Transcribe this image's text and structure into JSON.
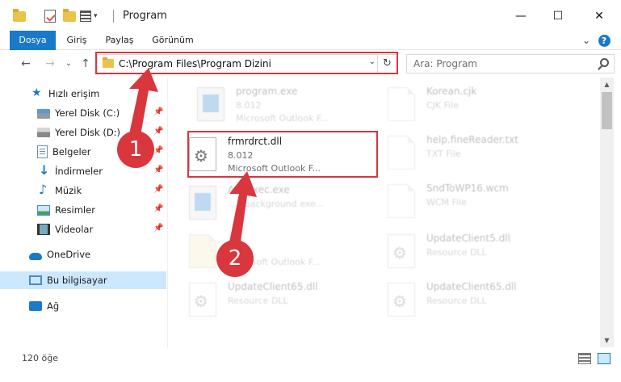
{
  "window": {
    "title": "Program",
    "minimize": "—",
    "maximize": "☐",
    "close": "✕"
  },
  "ribbon": {
    "tabs": [
      "Dosya",
      "Giriş",
      "Paylaş",
      "Görünüm"
    ],
    "expand": "⌄",
    "help": "?"
  },
  "nav": {
    "back": "←",
    "forward": "→",
    "recent": "⌄",
    "up": "↑",
    "address": "C:\\Program Files\\Program Dizini",
    "address_drop": "⌄",
    "refresh": "↻",
    "search_placeholder": "Ara: Program"
  },
  "sidebar": {
    "items": [
      {
        "label": "Hızlı erişim",
        "icon": "star-icon"
      },
      {
        "label": "Yerel Disk (C:)",
        "icon": "drive-icon",
        "pinned": true
      },
      {
        "label": "Yerel Disk (D:)",
        "icon": "drive-icon",
        "pinned": true
      },
      {
        "label": "Belgeler",
        "icon": "documents-icon",
        "pinned": true
      },
      {
        "label": "İndirmeler",
        "icon": "downloads-icon",
        "pinned": true
      },
      {
        "label": "Müzik",
        "icon": "music-icon",
        "pinned": true
      },
      {
        "label": "Resimler",
        "icon": "pictures-icon",
        "pinned": true
      },
      {
        "label": "Videolar",
        "icon": "videos-icon",
        "pinned": true
      },
      {
        "label": "OneDrive",
        "icon": "onedrive-icon"
      },
      {
        "label": "Bu bilgisayar",
        "icon": "computer-icon",
        "selected": true
      },
      {
        "label": "Ağ",
        "icon": "network-icon"
      }
    ]
  },
  "files": {
    "col1": [
      {
        "name": "program.exe",
        "line1": "8.012",
        "line2": "Microsoft Outlook F..."
      },
      {
        "name": "frmrdrct.dll",
        "line1": "8.012",
        "line2": "Microsoft Outlook F..."
      },
      {
        "name": "AppExec.exe",
        "line1": "",
        "line2": "...T background exe..."
      },
      {
        "name": "...",
        "line1": "",
        "line2": "Microsoft Outlook F..."
      },
      {
        "name": "UpdateClient65.dll",
        "line1": "Resource DLL",
        "line2": ""
      }
    ],
    "col2": [
      {
        "name": "Korean.cjk",
        "line1": "CJK File",
        "line2": ""
      },
      {
        "name": "help.fineReader.txt",
        "line1": "TXT File",
        "line2": ""
      },
      {
        "name": "SndToWP16.wcm",
        "line1": "WCM File",
        "line2": ""
      },
      {
        "name": "UpdateClient5.dll",
        "line1": "Resource DLL",
        "line2": ""
      },
      {
        "name": "UpdateClient65.dll",
        "line1": "Resource DLL",
        "line2": ""
      }
    ]
  },
  "annotations": {
    "step1": "1",
    "step2": "2"
  },
  "status": {
    "item_count": "120 öğe"
  },
  "colors": {
    "accent": "#1979ca",
    "highlight": "#d9363e",
    "selected": "#cce8ff"
  }
}
